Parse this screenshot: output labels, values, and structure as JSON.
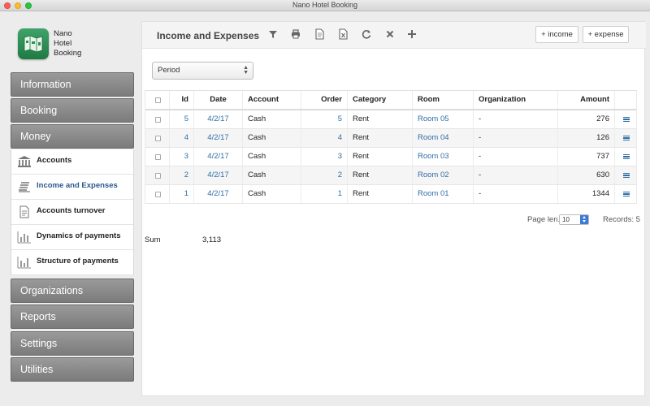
{
  "window": {
    "title": "Nano Hotel Booking"
  },
  "app": {
    "name_lines": [
      "Nano",
      "Hotel",
      "Booking"
    ]
  },
  "nav": {
    "items": [
      {
        "label": "Information"
      },
      {
        "label": "Booking"
      },
      {
        "label": "Money"
      },
      {
        "label": "Organizations"
      },
      {
        "label": "Reports"
      },
      {
        "label": "Settings"
      },
      {
        "label": "Utilities"
      }
    ],
    "money_subitems": [
      {
        "label": "Accounts",
        "icon": "bank-icon"
      },
      {
        "label": "Income and Expenses",
        "icon": "stack-icon",
        "active": true
      },
      {
        "label": "Accounts turnover",
        "icon": "document-icon"
      },
      {
        "label": "Dynamics of payments",
        "icon": "bar-chart-icon"
      },
      {
        "label": "Structure of payments",
        "icon": "bar-chart-icon"
      }
    ]
  },
  "toolbar": {
    "title": "Income and Expenses",
    "icons": [
      "filter-icon",
      "print-icon",
      "document-icon",
      "excel-icon",
      "refresh-icon",
      "close-icon",
      "plus-icon"
    ],
    "income_label": "+ income",
    "expense_label": "+ expense"
  },
  "filter": {
    "period_label": "Period"
  },
  "table": {
    "columns": [
      "Id",
      "Date",
      "Account",
      "Order",
      "Category",
      "Room",
      "Organization",
      "Amount"
    ],
    "rows": [
      {
        "id": "5",
        "date": "4/2/17",
        "account": "Cash",
        "order": "5",
        "category": "Rent",
        "room": "Room 05",
        "organization": "-",
        "amount": "276"
      },
      {
        "id": "4",
        "date": "4/2/17",
        "account": "Cash",
        "order": "4",
        "category": "Rent",
        "room": "Room 04",
        "organization": "-",
        "amount": "126"
      },
      {
        "id": "3",
        "date": "4/2/17",
        "account": "Cash",
        "order": "3",
        "category": "Rent",
        "room": "Room 03",
        "organization": "-",
        "amount": "737"
      },
      {
        "id": "2",
        "date": "4/2/17",
        "account": "Cash",
        "order": "2",
        "category": "Rent",
        "room": "Room 02",
        "organization": "-",
        "amount": "630"
      },
      {
        "id": "1",
        "date": "4/2/17",
        "account": "Cash",
        "order": "1",
        "category": "Rent",
        "room": "Room 01",
        "organization": "-",
        "amount": "1344"
      }
    ]
  },
  "pagination": {
    "page_len_label": "Page len.",
    "page_len_value": "10",
    "records_label": "Records: 5"
  },
  "summary": {
    "sum_label": "Sum",
    "sum_value": "3,113"
  },
  "colors": {
    "accent_link": "#2f6ea5",
    "nav_button": "#8a8a8a",
    "logo_green": "#2e8f55"
  }
}
